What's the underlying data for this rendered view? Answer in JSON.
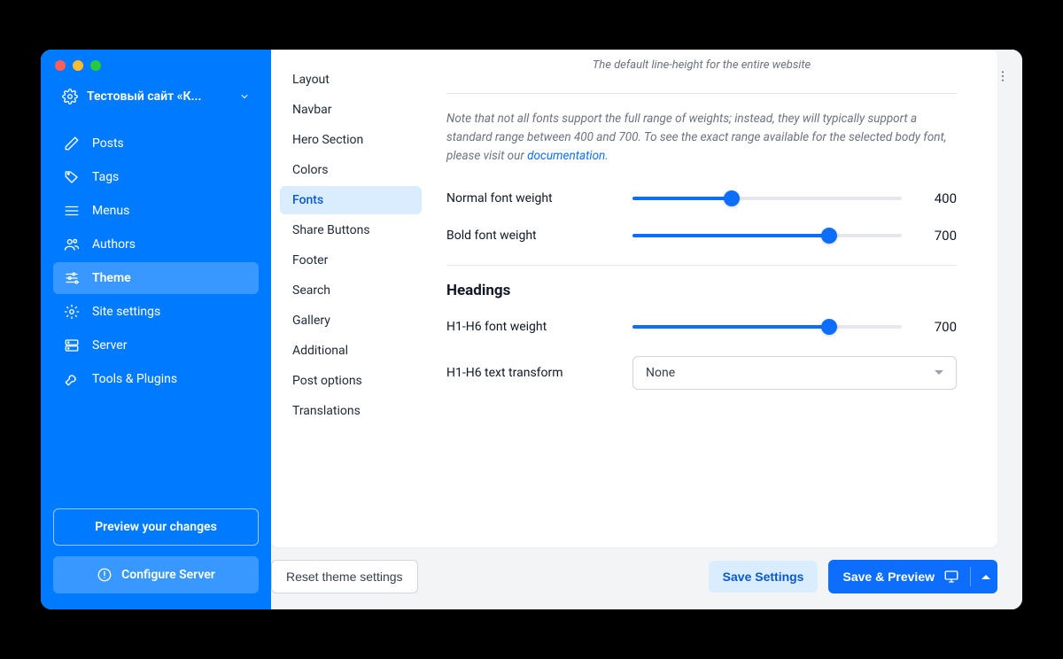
{
  "site_switcher": {
    "name": "Тестовый сайт «К..."
  },
  "sidebar": {
    "items": [
      {
        "label": "Posts"
      },
      {
        "label": "Tags"
      },
      {
        "label": "Menus"
      },
      {
        "label": "Authors"
      },
      {
        "label": "Theme"
      },
      {
        "label": "Site settings"
      },
      {
        "label": "Server"
      },
      {
        "label": "Tools & Plugins"
      }
    ],
    "preview_label": "Preview your changes",
    "configure_label": "Configure Server"
  },
  "subnav": {
    "items": [
      {
        "label": "Layout"
      },
      {
        "label": "Navbar"
      },
      {
        "label": "Hero Section"
      },
      {
        "label": "Colors"
      },
      {
        "label": "Fonts"
      },
      {
        "label": "Share Buttons"
      },
      {
        "label": "Footer"
      },
      {
        "label": "Search"
      },
      {
        "label": "Gallery"
      },
      {
        "label": "Additional"
      },
      {
        "label": "Post options"
      },
      {
        "label": "Translations"
      }
    ]
  },
  "panel": {
    "line_height_desc": "The default line-height for the entire website",
    "font_note_pre": "Note that not all fonts support the full range of weights; instead, they will typically support a standard range between 400 and 700. To see the exact range available for the selected body font, please visit our ",
    "font_note_link": "documentation",
    "font_note_post": ".",
    "normal_weight_label": "Normal font weight",
    "normal_weight_value": "400",
    "bold_weight_label": "Bold font weight",
    "bold_weight_value": "700",
    "headings_title": "Headings",
    "h_weight_label": "H1-H6 font weight",
    "h_weight_value": "700",
    "h_transform_label": "H1-H6 text transform",
    "h_transform_value": "None"
  },
  "footer": {
    "reset_label": "Reset theme settings",
    "save_label": "Save Settings",
    "save_preview_label": "Save & Preview"
  }
}
